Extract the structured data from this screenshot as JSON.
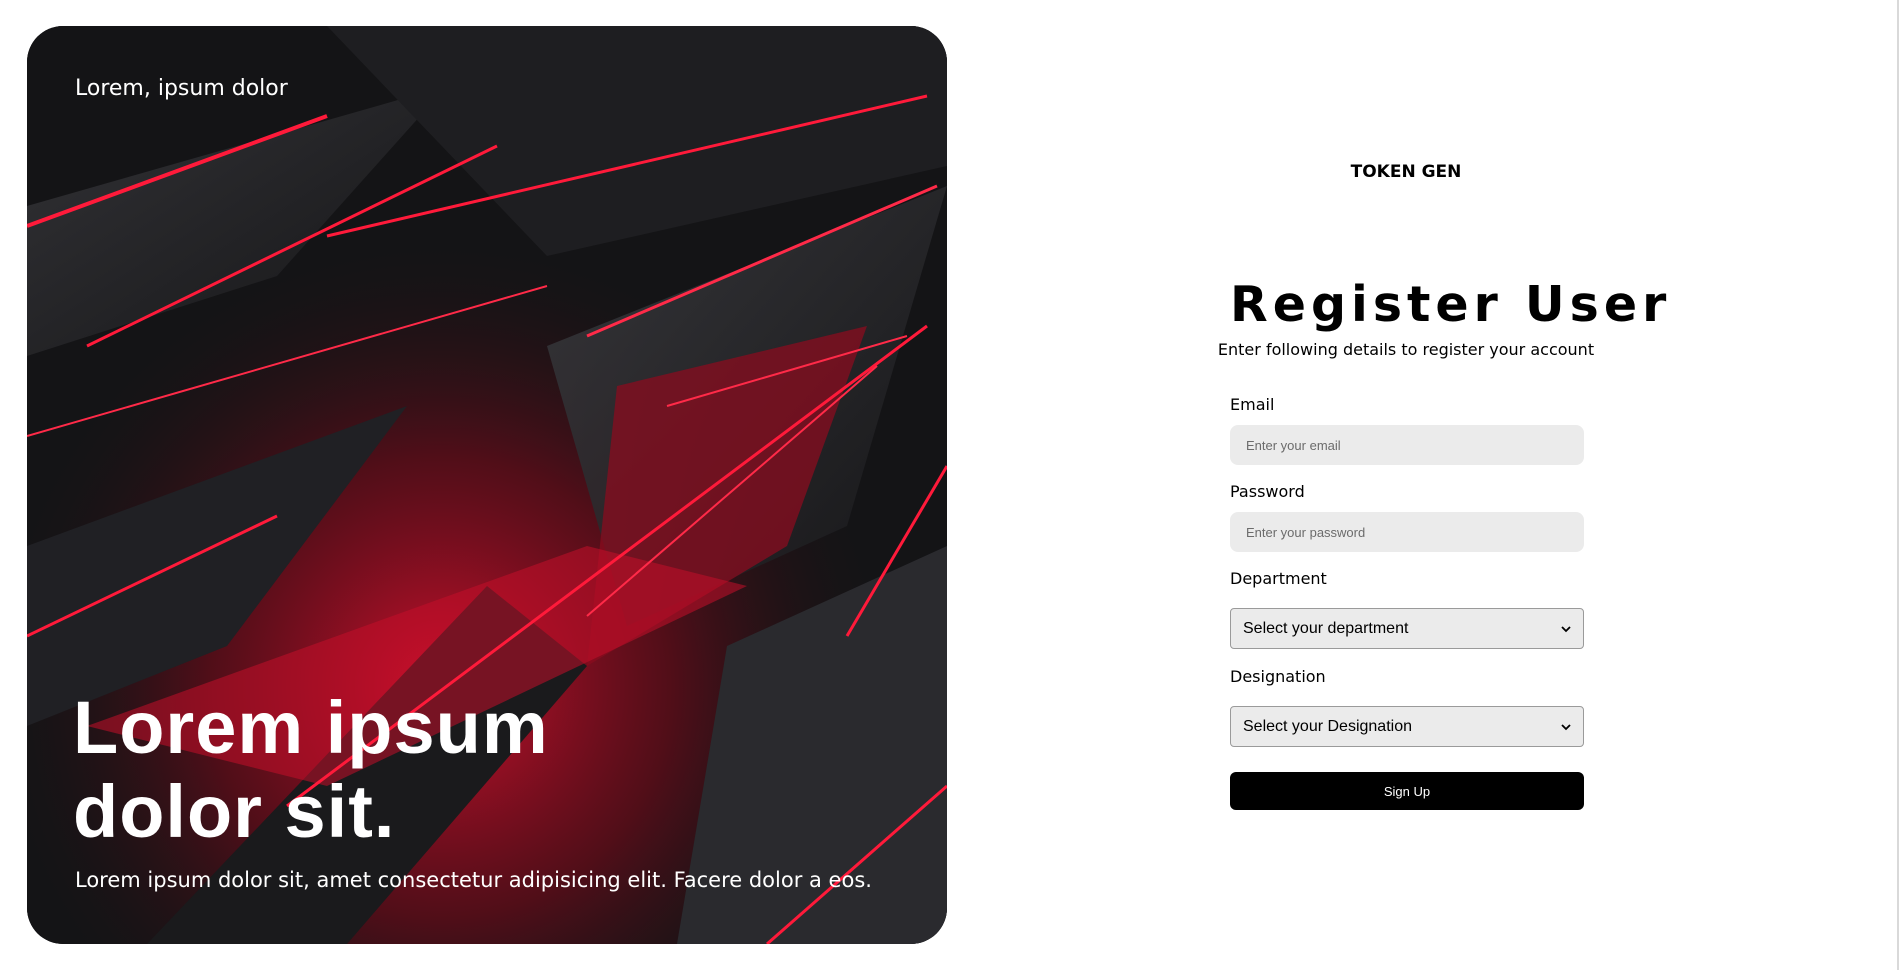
{
  "hero": {
    "brand": "Lorem, ipsum dolor",
    "title_line1": "Lorem ipsum",
    "title_line2": "dolor sit.",
    "subtitle": "Lorem ipsum dolor sit, amet consectetur adipisicing elit. Facere dolor a eos."
  },
  "app": {
    "name": "TOKEN GEN"
  },
  "form": {
    "title": "Register User",
    "subtitle": "Enter following details to register your account",
    "email_label": "Email",
    "email_placeholder": "Enter your email",
    "password_label": "Password",
    "password_placeholder": "Enter your password",
    "department_label": "Department",
    "department_selected": "Select your department",
    "designation_label": "Designation",
    "designation_selected": "Select your Designation",
    "submit_label": "Sign Up"
  },
  "colors": {
    "accent_red": "#e0102f",
    "dark_bg": "#121214",
    "button_bg": "#000000",
    "input_bg": "#ebebeb"
  },
  "icons": [
    "chevron-down-icon"
  ]
}
